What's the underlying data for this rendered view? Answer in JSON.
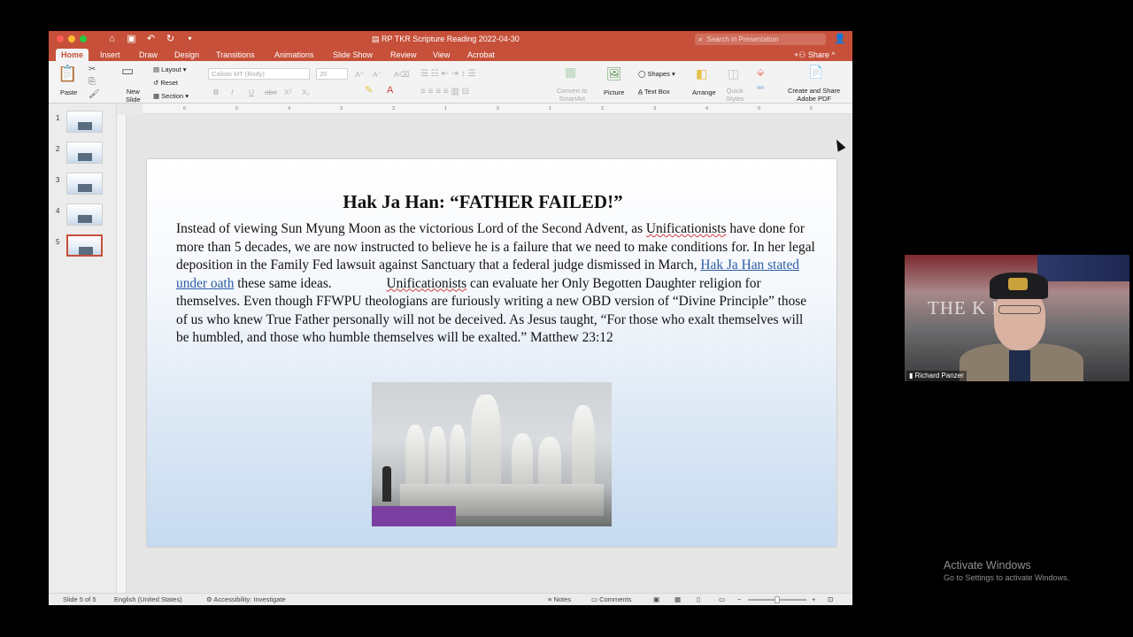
{
  "window": {
    "title": "RP TKR Scripture Reading 2022-04-30",
    "search_placeholder": "Search in Presentation",
    "share_label": "Share"
  },
  "tabs": [
    {
      "label": "Home",
      "active": true
    },
    {
      "label": "Insert"
    },
    {
      "label": "Draw"
    },
    {
      "label": "Design"
    },
    {
      "label": "Transitions"
    },
    {
      "label": "Animations"
    },
    {
      "label": "Slide Show"
    },
    {
      "label": "Review"
    },
    {
      "label": "View"
    },
    {
      "label": "Acrobat"
    }
  ],
  "ribbon": {
    "paste": "Paste",
    "new_slide": "New\nSlide",
    "layout": "Layout",
    "reset": "Reset",
    "section": "Section",
    "font_name": "Calisto MT (Body)",
    "font_size": "20",
    "bold": "B",
    "italic": "I",
    "underline": "U",
    "strikethrough": "abc",
    "superscript": "X²",
    "subscript": "X₂",
    "convert_smartart": "Convert to\nSmartArt",
    "picture": "Picture",
    "shapes": "Shapes",
    "text_box": "Text Box",
    "arrange": "Arrange",
    "quick_styles": "Quick\nStyles",
    "create_pdf": "Create and Share\nAdobe PDF"
  },
  "ruler_ticks": [
    "6",
    "5",
    "4",
    "3",
    "2",
    "1",
    "0",
    "1",
    "2",
    "3",
    "4",
    "5",
    "6"
  ],
  "thumbnails": [
    {
      "num": "1"
    },
    {
      "num": "2"
    },
    {
      "num": "3"
    },
    {
      "num": "4"
    },
    {
      "num": "5",
      "selected": true
    }
  ],
  "slide": {
    "title": "Hak Ja Han: “FATHER FAILED!”",
    "p1": "Instead of viewing Sun Myung Moon as the victorious Lord of the Second Advent, as",
    "p1_word": "Unificationists",
    "p1b": " have done for more than 5 decades, we are now instructed to believe he is a failure that we need to make conditions for. In her legal deposition in the Family Fed lawsuit against Sanctuary that a federal judge dismissed in March, ",
    "link": "Hak Ja Han stated under oath",
    "p1c": " these same ideas.",
    "p2_word": "Unificationists",
    "p2": " can evaluate her Only Begotten Daughter religion for themselves. Even though FFWPU theologians are furiously writing a new OBD version of “Divine Principle” those of us who knew True Father personally will not be deceived. As Jesus taught, “For those who exalt themselves will be humbled, and those who humble themselves will be exalted.” Matthew 23:12"
  },
  "status": {
    "slide_of": "Slide 5 of 5",
    "language": "English (United States)",
    "accessibility": "Accessibility: Investigate",
    "notes": "Notes",
    "comments": "Comments"
  },
  "webcam": {
    "participant": "Richard Panzer",
    "banner": "THE K     PORT"
  },
  "os_watermark": {
    "line1": "Activate Windows",
    "line2": "Go to Settings to activate Windows."
  },
  "colors": {
    "accent": "#c6503a",
    "link": "#2b5da6"
  }
}
